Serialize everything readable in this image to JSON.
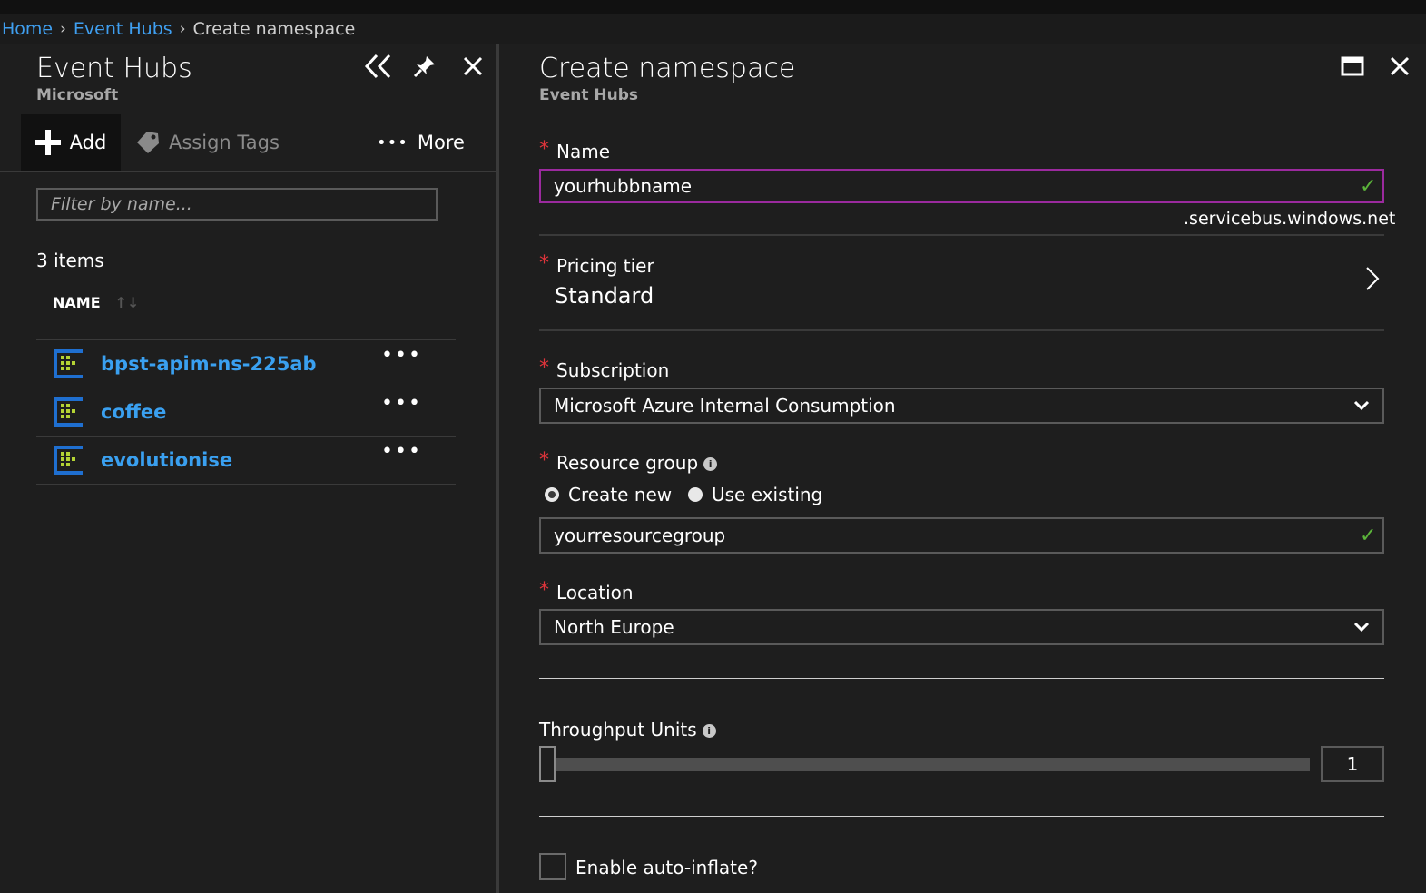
{
  "breadcrumb": {
    "home": "Home",
    "sep": "›",
    "event_hubs": "Event Hubs",
    "current": "Create namespace"
  },
  "left_blade": {
    "title": "Event Hubs",
    "subtitle": "Microsoft",
    "toolbar": {
      "add": "Add",
      "assign_tags": "Assign Tags",
      "more": "More"
    },
    "filter_placeholder": "Filter by name...",
    "count": "3 items",
    "column": "NAME",
    "items": [
      {
        "name": "bpst-apim-ns-225ab",
        "dots": "•••"
      },
      {
        "name": "coffee",
        "dots": "•••"
      },
      {
        "name": "evolutionise",
        "dots": "•••"
      }
    ]
  },
  "right_blade": {
    "title": "Create namespace",
    "subtitle": "Event Hubs",
    "required_mark": "*",
    "name": {
      "label": "Name",
      "value": "yourhubbname",
      "suffix": ".servicebus.windows.net"
    },
    "pricing": {
      "label": "Pricing tier",
      "value": "Standard"
    },
    "subscription": {
      "label": "Subscription",
      "value": "Microsoft Azure Internal Consumption"
    },
    "resource_group": {
      "label": "Resource group",
      "info": "i",
      "create_new": "Create new",
      "use_existing": "Use existing",
      "selected": "create_new",
      "value": "yourresourcegroup"
    },
    "location": {
      "label": "Location",
      "value": "North Europe"
    },
    "throughput": {
      "label": "Throughput Units",
      "info": "i",
      "value": "1",
      "min": 1,
      "max": 20
    },
    "auto_inflate": {
      "label": "Enable auto-inflate?",
      "checked": false
    }
  },
  "icons": {
    "check": "✓",
    "chevron_right": "chevron-right-icon",
    "chevron_down": "chevron-down-icon",
    "collapse": "double-chevron-left-icon",
    "pin": "pin-icon",
    "close": "close-icon",
    "maximize": "maximize-icon",
    "event_hub": "event-hub-icon",
    "tag": "tag-icon",
    "plus": "plus-icon",
    "sort": "sort-icon",
    "more_dots": "•••"
  },
  "colors": {
    "background": "#1e1e1e",
    "link": "#3aa0f0",
    "required": "#e0343b",
    "valid": "#5bb43a",
    "focus_border": "#9b2a9e"
  }
}
